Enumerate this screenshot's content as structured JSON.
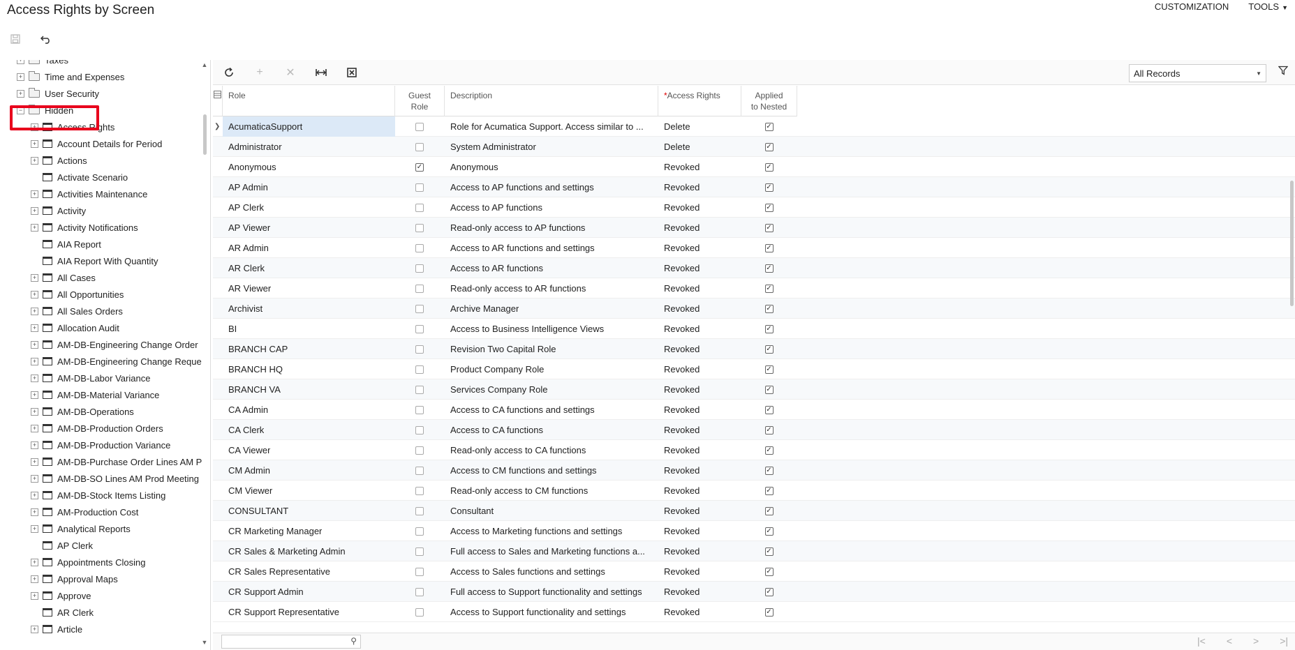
{
  "header": {
    "title": "Access Rights by Screen",
    "menu": [
      {
        "label": "CUSTOMIZATION"
      },
      {
        "label": "TOOLS"
      }
    ]
  },
  "tree": {
    "items": [
      {
        "label": "Taxes",
        "kind": "folder",
        "expander": "+",
        "level": 0
      },
      {
        "label": "Time and Expenses",
        "kind": "folder",
        "expander": "+",
        "level": 0
      },
      {
        "label": "User Security",
        "kind": "folder",
        "expander": "+",
        "level": 0
      },
      {
        "label": "Hidden",
        "kind": "folder",
        "expander": "−",
        "level": 0
      },
      {
        "label": "Access Rights",
        "kind": "screen",
        "expander": "+",
        "level": 1
      },
      {
        "label": "Account Details for Period",
        "kind": "screen",
        "expander": "+",
        "level": 1
      },
      {
        "label": "Actions",
        "kind": "screen",
        "expander": "+",
        "level": 1
      },
      {
        "label": "Activate Scenario",
        "kind": "screen",
        "expander": "",
        "level": 1
      },
      {
        "label": "Activities Maintenance",
        "kind": "screen",
        "expander": "+",
        "level": 1
      },
      {
        "label": "Activity",
        "kind": "screen",
        "expander": "+",
        "level": 1
      },
      {
        "label": "Activity Notifications",
        "kind": "screen",
        "expander": "+",
        "level": 1
      },
      {
        "label": "AIA Report",
        "kind": "screen",
        "expander": "",
        "level": 1
      },
      {
        "label": "AIA Report With Quantity",
        "kind": "screen",
        "expander": "",
        "level": 1
      },
      {
        "label": "All Cases",
        "kind": "screen",
        "expander": "+",
        "level": 1
      },
      {
        "label": "All Opportunities",
        "kind": "screen",
        "expander": "+",
        "level": 1
      },
      {
        "label": "All Sales Orders",
        "kind": "screen",
        "expander": "+",
        "level": 1
      },
      {
        "label": "Allocation Audit",
        "kind": "screen",
        "expander": "+",
        "level": 1
      },
      {
        "label": "AM-DB-Engineering Change Order",
        "kind": "screen",
        "expander": "+",
        "level": 1
      },
      {
        "label": "AM-DB-Engineering Change Reque",
        "kind": "screen",
        "expander": "+",
        "level": 1
      },
      {
        "label": "AM-DB-Labor Variance",
        "kind": "screen",
        "expander": "+",
        "level": 1
      },
      {
        "label": "AM-DB-Material Variance",
        "kind": "screen",
        "expander": "+",
        "level": 1
      },
      {
        "label": "AM-DB-Operations",
        "kind": "screen",
        "expander": "+",
        "level": 1
      },
      {
        "label": "AM-DB-Production Orders",
        "kind": "screen",
        "expander": "+",
        "level": 1
      },
      {
        "label": "AM-DB-Production Variance",
        "kind": "screen",
        "expander": "+",
        "level": 1
      },
      {
        "label": "AM-DB-Purchase Order Lines AM P",
        "kind": "screen",
        "expander": "+",
        "level": 1
      },
      {
        "label": "AM-DB-SO Lines AM Prod Meeting",
        "kind": "screen",
        "expander": "+",
        "level": 1
      },
      {
        "label": "AM-DB-Stock Items Listing",
        "kind": "screen",
        "expander": "+",
        "level": 1
      },
      {
        "label": "AM-Production Cost",
        "kind": "screen",
        "expander": "+",
        "level": 1
      },
      {
        "label": "Analytical Reports",
        "kind": "screen",
        "expander": "+",
        "level": 1
      },
      {
        "label": "AP Clerk",
        "kind": "screen",
        "expander": "",
        "level": 1
      },
      {
        "label": "Appointments Closing",
        "kind": "screen",
        "expander": "+",
        "level": 1
      },
      {
        "label": "Approval Maps",
        "kind": "screen",
        "expander": "+",
        "level": 1
      },
      {
        "label": "Approve",
        "kind": "screen",
        "expander": "+",
        "level": 1
      },
      {
        "label": "AR Clerk",
        "kind": "screen",
        "expander": "",
        "level": 1
      },
      {
        "label": "Article",
        "kind": "screen",
        "expander": "+",
        "level": 1
      }
    ]
  },
  "grid": {
    "filter": {
      "selected": "All Records"
    },
    "columns": {
      "role": "Role",
      "guest_line1": "Guest",
      "guest_line2": "Role",
      "description": "Description",
      "access_required": "*",
      "access": "Access Rights",
      "applied_line1": "Applied",
      "applied_line2": "to Nested"
    },
    "rows": [
      {
        "role": "AcumaticaSupport",
        "guest": false,
        "description": "Role for Acumatica Support. Access similar to ...",
        "access": "Delete",
        "applied": true
      },
      {
        "role": "Administrator",
        "guest": false,
        "description": "System Administrator",
        "access": "Delete",
        "applied": true
      },
      {
        "role": "Anonymous",
        "guest": true,
        "description": "Anonymous",
        "access": "Revoked",
        "applied": true
      },
      {
        "role": "AP Admin",
        "guest": false,
        "description": "Access to AP functions and settings",
        "access": "Revoked",
        "applied": true
      },
      {
        "role": "AP Clerk",
        "guest": false,
        "description": "Access to AP functions",
        "access": "Revoked",
        "applied": true
      },
      {
        "role": "AP Viewer",
        "guest": false,
        "description": "Read-only access to AP functions",
        "access": "Revoked",
        "applied": true
      },
      {
        "role": "AR Admin",
        "guest": false,
        "description": "Access to AR functions and settings",
        "access": "Revoked",
        "applied": true
      },
      {
        "role": "AR Clerk",
        "guest": false,
        "description": "Access to AR functions",
        "access": "Revoked",
        "applied": true
      },
      {
        "role": "AR Viewer",
        "guest": false,
        "description": "Read-only access to AR functions",
        "access": "Revoked",
        "applied": true
      },
      {
        "role": "Archivist",
        "guest": false,
        "description": "Archive Manager",
        "access": "Revoked",
        "applied": true
      },
      {
        "role": "BI",
        "guest": false,
        "description": "Access to Business Intelligence Views",
        "access": "Revoked",
        "applied": true
      },
      {
        "role": "BRANCH CAP",
        "guest": false,
        "description": "Revision Two Capital Role",
        "access": "Revoked",
        "applied": true
      },
      {
        "role": "BRANCH HQ",
        "guest": false,
        "description": "Product Company Role",
        "access": "Revoked",
        "applied": true
      },
      {
        "role": "BRANCH VA",
        "guest": false,
        "description": "Services Company Role",
        "access": "Revoked",
        "applied": true
      },
      {
        "role": "CA Admin",
        "guest": false,
        "description": "Access to CA functions and settings",
        "access": "Revoked",
        "applied": true
      },
      {
        "role": "CA Clerk",
        "guest": false,
        "description": "Access to CA functions",
        "access": "Revoked",
        "applied": true
      },
      {
        "role": "CA Viewer",
        "guest": false,
        "description": "Read-only access to CA functions",
        "access": "Revoked",
        "applied": true
      },
      {
        "role": "CM Admin",
        "guest": false,
        "description": "Access to CM functions and settings",
        "access": "Revoked",
        "applied": true
      },
      {
        "role": "CM Viewer",
        "guest": false,
        "description": "Read-only access to CM functions",
        "access": "Revoked",
        "applied": true
      },
      {
        "role": "CONSULTANT",
        "guest": false,
        "description": "Consultant",
        "access": "Revoked",
        "applied": true
      },
      {
        "role": "CR Marketing Manager",
        "guest": false,
        "description": "Access to Marketing functions and settings",
        "access": "Revoked",
        "applied": true
      },
      {
        "role": "CR Sales & Marketing Admin",
        "guest": false,
        "description": "Full access to Sales and Marketing functions a...",
        "access": "Revoked",
        "applied": true
      },
      {
        "role": "CR Sales Representative",
        "guest": false,
        "description": "Access to Sales functions and settings",
        "access": "Revoked",
        "applied": true
      },
      {
        "role": "CR Support Admin",
        "guest": false,
        "description": "Full access to Support functionality and settings",
        "access": "Revoked",
        "applied": true
      },
      {
        "role": "CR Support Representative",
        "guest": false,
        "description": "Access to Support functionality and settings",
        "access": "Revoked",
        "applied": true
      }
    ]
  },
  "colors": {
    "highlight": "#e8001c",
    "selected_row": "#dce9f7"
  }
}
